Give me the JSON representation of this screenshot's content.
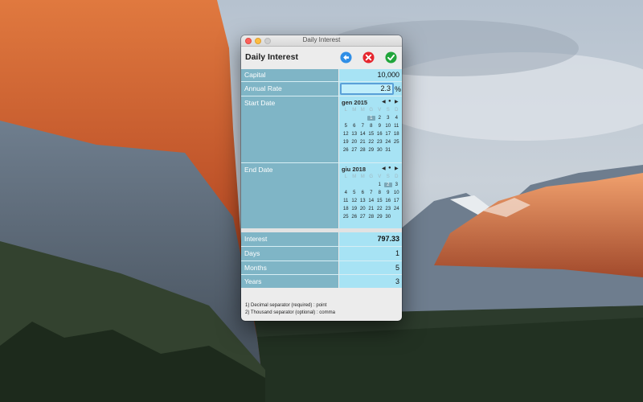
{
  "window": {
    "title": "Daily Interest"
  },
  "toolbar": {
    "app_title": "Daily Interest",
    "buttons": [
      {
        "name": "back",
        "icon": "arrow-left-icon",
        "color": "#2f8ee6"
      },
      {
        "name": "cancel",
        "icon": "x-circle-icon",
        "color": "#e6262e"
      },
      {
        "name": "confirm",
        "icon": "checkmark-icon",
        "color": "#20a53b"
      }
    ]
  },
  "form": {
    "capital": {
      "label": "Capital",
      "value": "10,000"
    },
    "annual_rate": {
      "label": "Annual Rate",
      "value": "2.3",
      "unit": "%"
    },
    "start_date": {
      "label": "Start Date"
    },
    "end_date": {
      "label": "End Date"
    }
  },
  "calendar_start": {
    "month_label": "gen 2015",
    "nav": [
      "◀",
      "●",
      "▶"
    ],
    "dow": [
      "L",
      "M",
      "M",
      "G",
      "V",
      "S",
      "D"
    ],
    "weeks": [
      [
        "",
        "",
        "",
        "1",
        "2",
        "3",
        "4"
      ],
      [
        "5",
        "6",
        "7",
        "8",
        "9",
        "10",
        "11"
      ],
      [
        "12",
        "13",
        "14",
        "15",
        "16",
        "17",
        "18"
      ],
      [
        "19",
        "20",
        "21",
        "22",
        "23",
        "24",
        "25"
      ],
      [
        "26",
        "27",
        "28",
        "29",
        "30",
        "31",
        ""
      ]
    ],
    "selected_day": "1"
  },
  "calendar_end": {
    "month_label": "giu 2018",
    "nav": [
      "◀",
      "●",
      "▶"
    ],
    "dow": [
      "L",
      "M",
      "M",
      "G",
      "V",
      "S",
      "D"
    ],
    "weeks": [
      [
        "",
        "",
        "",
        "",
        "1",
        "2",
        "3"
      ],
      [
        "4",
        "5",
        "6",
        "7",
        "8",
        "9",
        "10"
      ],
      [
        "11",
        "12",
        "13",
        "14",
        "15",
        "16",
        "17"
      ],
      [
        "18",
        "19",
        "20",
        "21",
        "22",
        "23",
        "24"
      ],
      [
        "25",
        "26",
        "27",
        "28",
        "29",
        "30",
        ""
      ]
    ],
    "selected_day": "2"
  },
  "results": {
    "interest": {
      "label": "Interest",
      "value": "797.33"
    },
    "days": {
      "label": "Days",
      "value": "1"
    },
    "months": {
      "label": "Months",
      "value": "5"
    },
    "years": {
      "label": "Years",
      "value": "3"
    }
  },
  "notes": [
    "1) Decimal separator (required) : point",
    "2) Thousand separator (optional) : comma"
  ],
  "colors": {
    "label_bg": "#7fb5c6",
    "value_bg": "#a7e3f4",
    "focus_ring": "#5aa0d8"
  }
}
